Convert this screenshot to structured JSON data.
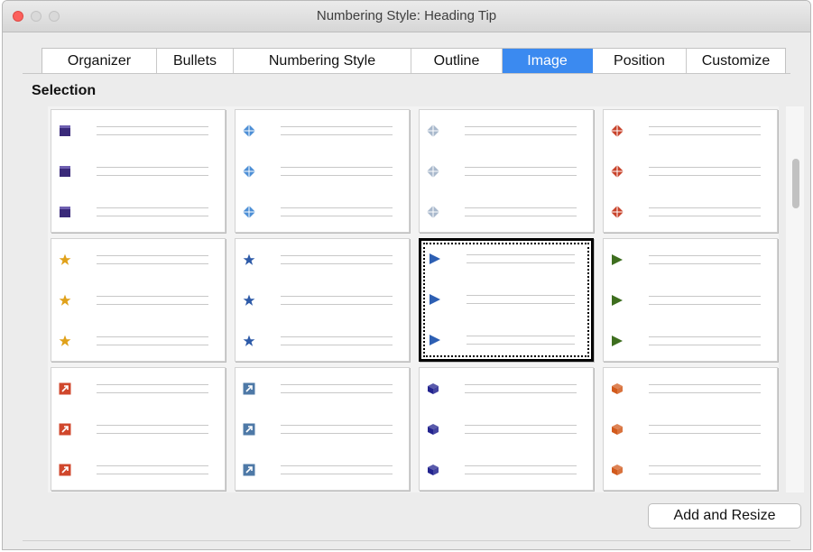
{
  "window": {
    "title": "Numbering Style: Heading Tip"
  },
  "tabs": [
    {
      "label": "Organizer",
      "active": false
    },
    {
      "label": "Bullets",
      "active": false
    },
    {
      "label": "Numbering Style",
      "active": false
    },
    {
      "label": "Outline",
      "active": false
    },
    {
      "label": "Image",
      "active": true
    },
    {
      "label": "Position",
      "active": false
    },
    {
      "label": "Customize",
      "active": false
    }
  ],
  "section": {
    "label": "Selection"
  },
  "gallery": {
    "selected_index": 6,
    "items": [
      {
        "icon": "purple-square-icon",
        "color": "#3a2a7a"
      },
      {
        "icon": "blue-diamond-icon",
        "color": "#4d8fd6"
      },
      {
        "icon": "gray-diamond-icon",
        "color": "#a8b8cc"
      },
      {
        "icon": "red-diamond-icon",
        "color": "#c8432b"
      },
      {
        "icon": "gold-star-icon",
        "color": "#e0a11a"
      },
      {
        "icon": "blue-star-icon",
        "color": "#2d5aa8"
      },
      {
        "icon": "blue-triangle-icon",
        "color": "#2d5fb3"
      },
      {
        "icon": "green-triangle-icon",
        "color": "#3e6e1f"
      },
      {
        "icon": "red-arrow-box-icon",
        "color": "#d0472c"
      },
      {
        "icon": "blue-arrow-box-icon",
        "color": "#4e79a7"
      },
      {
        "icon": "navy-cube-icon",
        "color": "#22238f"
      },
      {
        "icon": "orange-cube-icon",
        "color": "#d25a1c"
      }
    ]
  },
  "buttons": {
    "add_and_resize": "Add and Resize"
  }
}
